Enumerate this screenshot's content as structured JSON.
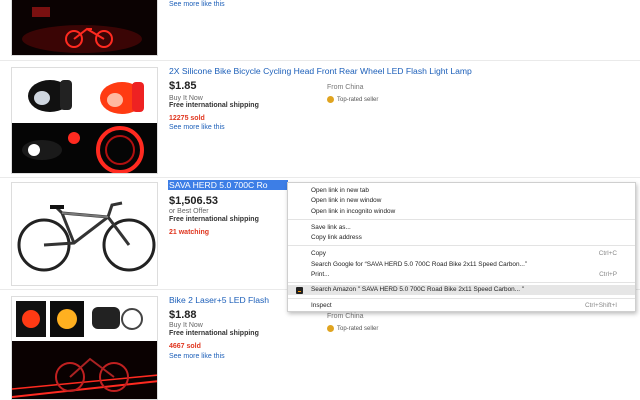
{
  "listings": [
    {
      "more": "See more like this"
    },
    {
      "title": "2X Silicone Bike Bicycle Cycling Head Front Rear Wheel LED Flash Light Lamp",
      "price": "$1.85",
      "format": "Buy It Now",
      "shipping": "Free international shipping",
      "sold": "12275 sold",
      "more": "See more like this",
      "from": "From China",
      "seller_badge": "Top-rated seller"
    },
    {
      "title_selected": "SAVA HERD 5.0 700C Ro",
      "title_tail": "...",
      "price": "$1,506.53",
      "format": "or Best Offer",
      "shipping": "Free international shipping",
      "watching": "21 watching"
    },
    {
      "title": "Bike 2 Laser+5 LED Flash",
      "price": "$1.88",
      "format": "Buy It Now",
      "shipping": "Free international shipping",
      "sold": "4667 sold",
      "more": "See more like this",
      "from": "From China",
      "seller_badge": "Top-rated seller"
    }
  ],
  "context_menu": {
    "items": [
      {
        "label": "Open link in new tab",
        "shortcut": ""
      },
      {
        "label": "Open link in new window",
        "shortcut": ""
      },
      {
        "label": "Open link in incognito window",
        "shortcut": ""
      },
      {
        "label": "Save link as...",
        "shortcut": ""
      },
      {
        "label": "Copy link address",
        "shortcut": ""
      },
      {
        "label": "Copy",
        "shortcut": "Ctrl+C"
      },
      {
        "label": "Search Google for “SAVA HERD 5.0 700C Road Bike 2x11 Speed Carbon...”",
        "shortcut": ""
      },
      {
        "label": "Print...",
        "shortcut": "Ctrl+P"
      },
      {
        "label": "Search Amazon \" SAVA HERD 5.0 700C Road Bike 2x11 Speed Carbon... \"",
        "shortcut": ""
      },
      {
        "label": "Inspect",
        "shortcut": "Ctrl+Shift+I"
      }
    ]
  },
  "colors": {
    "link": "#1c5fb9",
    "sold_red": "#e0361f",
    "selection": "#3d7ee6"
  }
}
